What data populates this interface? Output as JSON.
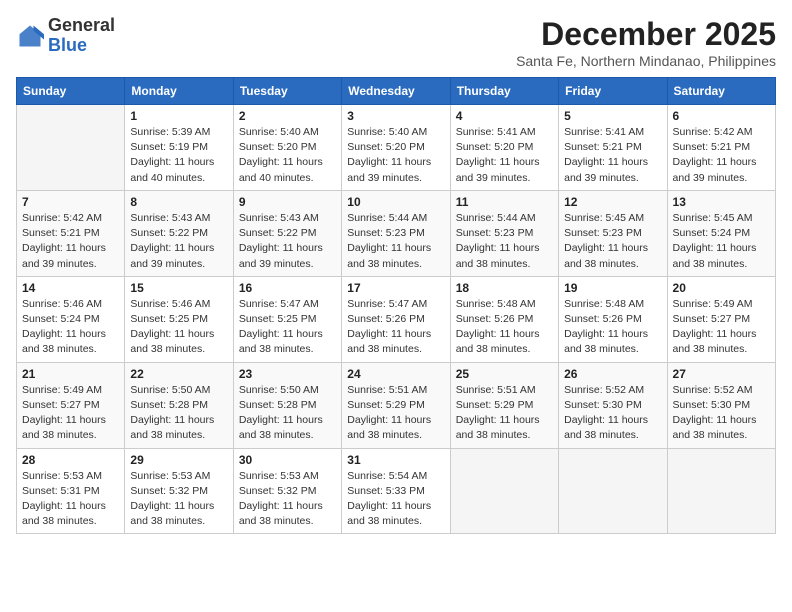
{
  "logo": {
    "general": "General",
    "blue": "Blue"
  },
  "header": {
    "month_year": "December 2025",
    "location": "Santa Fe, Northern Mindanao, Philippines"
  },
  "days_of_week": [
    "Sunday",
    "Monday",
    "Tuesday",
    "Wednesday",
    "Thursday",
    "Friday",
    "Saturday"
  ],
  "weeks": [
    [
      {
        "day": "",
        "info": ""
      },
      {
        "day": "1",
        "info": "Sunrise: 5:39 AM\nSunset: 5:19 PM\nDaylight: 11 hours\nand 40 minutes."
      },
      {
        "day": "2",
        "info": "Sunrise: 5:40 AM\nSunset: 5:20 PM\nDaylight: 11 hours\nand 40 minutes."
      },
      {
        "day": "3",
        "info": "Sunrise: 5:40 AM\nSunset: 5:20 PM\nDaylight: 11 hours\nand 39 minutes."
      },
      {
        "day": "4",
        "info": "Sunrise: 5:41 AM\nSunset: 5:20 PM\nDaylight: 11 hours\nand 39 minutes."
      },
      {
        "day": "5",
        "info": "Sunrise: 5:41 AM\nSunset: 5:21 PM\nDaylight: 11 hours\nand 39 minutes."
      },
      {
        "day": "6",
        "info": "Sunrise: 5:42 AM\nSunset: 5:21 PM\nDaylight: 11 hours\nand 39 minutes."
      }
    ],
    [
      {
        "day": "7",
        "info": "Sunrise: 5:42 AM\nSunset: 5:21 PM\nDaylight: 11 hours\nand 39 minutes."
      },
      {
        "day": "8",
        "info": "Sunrise: 5:43 AM\nSunset: 5:22 PM\nDaylight: 11 hours\nand 39 minutes."
      },
      {
        "day": "9",
        "info": "Sunrise: 5:43 AM\nSunset: 5:22 PM\nDaylight: 11 hours\nand 39 minutes."
      },
      {
        "day": "10",
        "info": "Sunrise: 5:44 AM\nSunset: 5:23 PM\nDaylight: 11 hours\nand 38 minutes."
      },
      {
        "day": "11",
        "info": "Sunrise: 5:44 AM\nSunset: 5:23 PM\nDaylight: 11 hours\nand 38 minutes."
      },
      {
        "day": "12",
        "info": "Sunrise: 5:45 AM\nSunset: 5:23 PM\nDaylight: 11 hours\nand 38 minutes."
      },
      {
        "day": "13",
        "info": "Sunrise: 5:45 AM\nSunset: 5:24 PM\nDaylight: 11 hours\nand 38 minutes."
      }
    ],
    [
      {
        "day": "14",
        "info": "Sunrise: 5:46 AM\nSunset: 5:24 PM\nDaylight: 11 hours\nand 38 minutes."
      },
      {
        "day": "15",
        "info": "Sunrise: 5:46 AM\nSunset: 5:25 PM\nDaylight: 11 hours\nand 38 minutes."
      },
      {
        "day": "16",
        "info": "Sunrise: 5:47 AM\nSunset: 5:25 PM\nDaylight: 11 hours\nand 38 minutes."
      },
      {
        "day": "17",
        "info": "Sunrise: 5:47 AM\nSunset: 5:26 PM\nDaylight: 11 hours\nand 38 minutes."
      },
      {
        "day": "18",
        "info": "Sunrise: 5:48 AM\nSunset: 5:26 PM\nDaylight: 11 hours\nand 38 minutes."
      },
      {
        "day": "19",
        "info": "Sunrise: 5:48 AM\nSunset: 5:26 PM\nDaylight: 11 hours\nand 38 minutes."
      },
      {
        "day": "20",
        "info": "Sunrise: 5:49 AM\nSunset: 5:27 PM\nDaylight: 11 hours\nand 38 minutes."
      }
    ],
    [
      {
        "day": "21",
        "info": "Sunrise: 5:49 AM\nSunset: 5:27 PM\nDaylight: 11 hours\nand 38 minutes."
      },
      {
        "day": "22",
        "info": "Sunrise: 5:50 AM\nSunset: 5:28 PM\nDaylight: 11 hours\nand 38 minutes."
      },
      {
        "day": "23",
        "info": "Sunrise: 5:50 AM\nSunset: 5:28 PM\nDaylight: 11 hours\nand 38 minutes."
      },
      {
        "day": "24",
        "info": "Sunrise: 5:51 AM\nSunset: 5:29 PM\nDaylight: 11 hours\nand 38 minutes."
      },
      {
        "day": "25",
        "info": "Sunrise: 5:51 AM\nSunset: 5:29 PM\nDaylight: 11 hours\nand 38 minutes."
      },
      {
        "day": "26",
        "info": "Sunrise: 5:52 AM\nSunset: 5:30 PM\nDaylight: 11 hours\nand 38 minutes."
      },
      {
        "day": "27",
        "info": "Sunrise: 5:52 AM\nSunset: 5:30 PM\nDaylight: 11 hours\nand 38 minutes."
      }
    ],
    [
      {
        "day": "28",
        "info": "Sunrise: 5:53 AM\nSunset: 5:31 PM\nDaylight: 11 hours\nand 38 minutes."
      },
      {
        "day": "29",
        "info": "Sunrise: 5:53 AM\nSunset: 5:32 PM\nDaylight: 11 hours\nand 38 minutes."
      },
      {
        "day": "30",
        "info": "Sunrise: 5:53 AM\nSunset: 5:32 PM\nDaylight: 11 hours\nand 38 minutes."
      },
      {
        "day": "31",
        "info": "Sunrise: 5:54 AM\nSunset: 5:33 PM\nDaylight: 11 hours\nand 38 minutes."
      },
      {
        "day": "",
        "info": ""
      },
      {
        "day": "",
        "info": ""
      },
      {
        "day": "",
        "info": ""
      }
    ]
  ]
}
